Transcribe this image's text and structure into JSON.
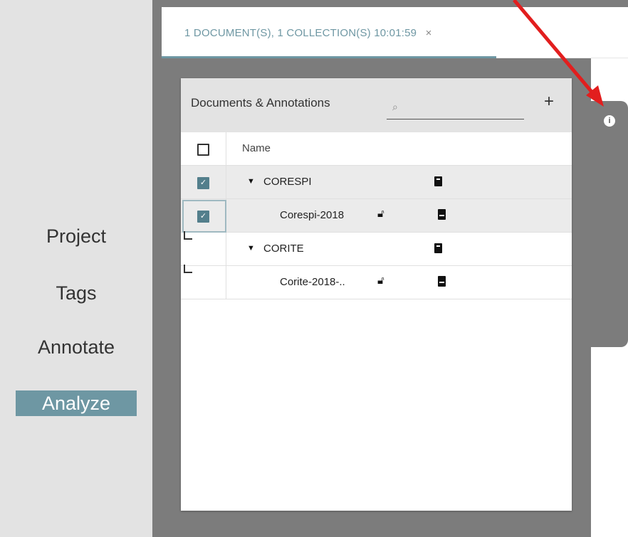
{
  "sidebar": {
    "items": [
      {
        "label": "Project"
      },
      {
        "label": "Tags"
      },
      {
        "label": "Annotate"
      },
      {
        "label": "Analyze"
      }
    ]
  },
  "tab": {
    "label": "1 DOCUMENT(S), 1 COLLECTION(S) 10:01:59",
    "close": "×"
  },
  "panel": {
    "title": "Documents & Annotations",
    "search_placeholder": "",
    "add": "+",
    "info": "i"
  },
  "table": {
    "header": "Name",
    "rows": [
      {
        "name": "CORESPI",
        "type": "collection",
        "expanded": true,
        "checked": true
      },
      {
        "name": "Corespi-2018",
        "type": "document",
        "locked": false,
        "checked": true
      },
      {
        "name": "CORITE",
        "type": "collection",
        "expanded": true,
        "checked": false
      },
      {
        "name": "Corite-2018-..",
        "type": "document",
        "locked": false,
        "checked": false
      }
    ]
  },
  "colors": {
    "accent": "#6e97a3",
    "checked": "#537f8c",
    "arrow": "#e21e1e"
  }
}
